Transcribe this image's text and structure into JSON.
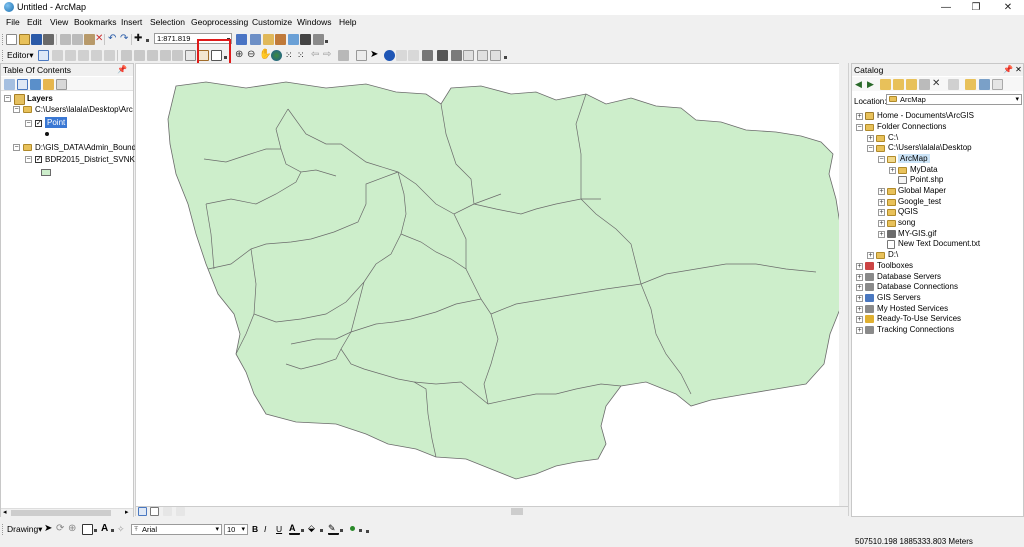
{
  "window": {
    "title": "Untitled - ArcMap",
    "minimize": "—",
    "restore": "❐",
    "close": "✕"
  },
  "menu": [
    "File",
    "Edit",
    "View",
    "Bookmarks",
    "Insert",
    "Selection",
    "Geoprocessing",
    "Customize",
    "Windows",
    "Help"
  ],
  "standard_toolbar": {
    "scale": "1:871.819"
  },
  "editor_toolbar": {
    "label": "Editor▾"
  },
  "toc": {
    "title": "Table Of Contents",
    "pin": "📌 ✕",
    "layers_label": "Layers",
    "group1_path": "C:\\Users\\lalala\\Desktop\\Arc",
    "layer_point": "Point",
    "group2_path": "D:\\GIS_DATA\\Admin_Bound",
    "layer_district": "BDR2015_District_SVNK"
  },
  "catalog": {
    "title": "Catalog",
    "pin": "📌 ✕",
    "location_label": "Location:",
    "location_value": "ArcMap",
    "items": [
      "Home - Documents\\ArcGIS",
      "Folder Connections",
      "C:\\",
      "C:\\Users\\lalala\\Desktop",
      "ArcMap",
      "MyData",
      "Point.shp",
      "Global Maper",
      "Google_test",
      "QGIS",
      "song",
      "MY-GIS.gif",
      "New Text Document.txt",
      "D:\\",
      "Toolboxes",
      "Database Servers",
      "Database Connections",
      "GIS Servers",
      "My Hosted Services",
      "Ready-To-Use Services",
      "Tracking Connections"
    ]
  },
  "drawing_toolbar": {
    "drawing": "Drawing▾",
    "font": "Arial",
    "size": "10",
    "bold": "B",
    "italic": "I",
    "underline": "U"
  },
  "status": {
    "coords": "507510.198  1885333.803 Meters"
  },
  "colors": {
    "polygon_fill": "#cdeecb",
    "polygon_stroke": "#6b6b6b",
    "highlight": "#e01a1a"
  }
}
